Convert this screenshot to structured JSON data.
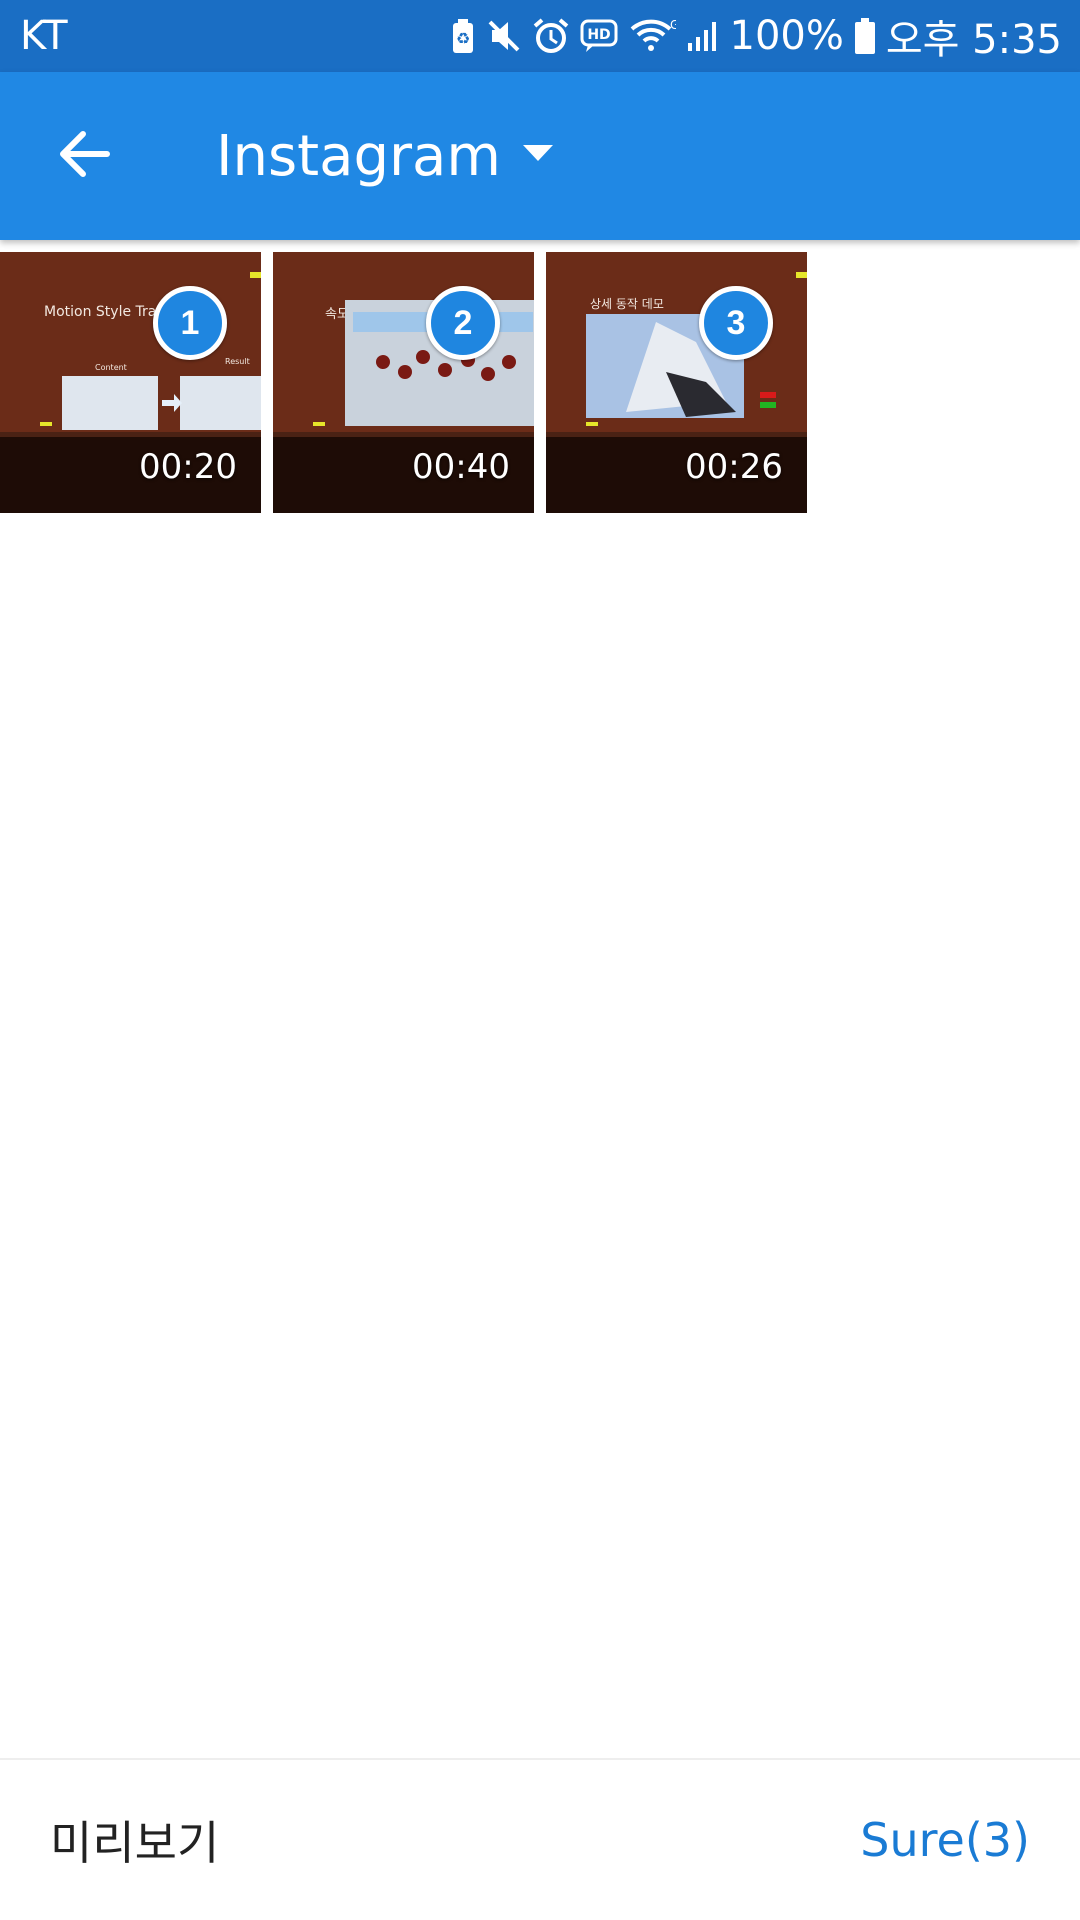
{
  "status_bar": {
    "carrier": "KT",
    "battery_percent": "100%",
    "time": "오후 5:35",
    "icons": [
      "battery-saver-icon",
      "mute-icon",
      "alarm-icon",
      "hd-icon",
      "wifi-icon",
      "signal-icon",
      "battery-icon"
    ]
  },
  "app_bar": {
    "back_icon": "arrow-left-icon",
    "title": "Instagram",
    "dropdown_icon": "caret-down-icon"
  },
  "items": [
    {
      "order": "1",
      "duration": "00:20",
      "slide_text": "Motion Style Transfer",
      "sub_a": "Content",
      "sub_b": "Result"
    },
    {
      "order": "2",
      "duration": "00:40",
      "slide_text": "속도 측정"
    },
    {
      "order": "3",
      "duration": "00:26",
      "slide_text": "상세 동작 데모"
    }
  ],
  "bottom_bar": {
    "preview_label": "미리보기",
    "done_label": "Sure(3)"
  },
  "colors": {
    "status_bar": "#1a6ec4",
    "app_bar": "#2088e4",
    "accent": "#1f86e0",
    "done_text": "#1a7bd4"
  }
}
